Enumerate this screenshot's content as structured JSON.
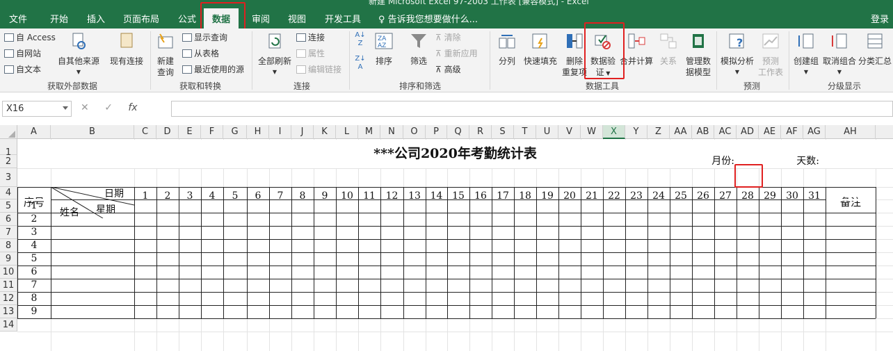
{
  "window": {
    "title": "新建 Microsoft Excel 97-2003 工作表 [兼容模式] - Excel"
  },
  "tabs": [
    "文件",
    "开始",
    "插入",
    "页面布局",
    "公式",
    "数据",
    "审阅",
    "视图",
    "开发工具"
  ],
  "active_tab": "数据",
  "tell_me": "告诉我您想要做什么...",
  "login": "登录",
  "ribbon": {
    "get_external": {
      "access": "自 Access",
      "web": "自网站",
      "text": "自文本",
      "other": "自其他来源",
      "existing": "现有连接",
      "label": "获取外部数据"
    },
    "get_transform": {
      "new_query_1": "新建",
      "new_query_2": "查询",
      "show_query": "显示查询",
      "from_table": "从表格",
      "recent": "最近使用的源",
      "label": "获取和转换"
    },
    "connections": {
      "refresh_all": "全部刷新",
      "connections": "连接",
      "properties": "属性",
      "edit_links": "编辑链接",
      "label": "连接"
    },
    "sort_filter": {
      "sort": "排序",
      "filter": "筛选",
      "clear": "清除",
      "reapply": "重新应用",
      "advanced": "高级",
      "label": "排序和筛选"
    },
    "data_tools": {
      "split": "分列",
      "flash_fill": "快速填充",
      "remove_dup_1": "删除",
      "remove_dup_2": "重复项",
      "validation_1": "数据验",
      "validation_2": "证",
      "consolidate": "合并计算",
      "relations": "关系",
      "manage_model_1": "管理数",
      "manage_model_2": "据模型",
      "label": "数据工具"
    },
    "forecast": {
      "what_if": "模拟分析",
      "forecast_1": "预测",
      "forecast_2": "工作表",
      "label": "预测"
    },
    "outline": {
      "group": "创建组",
      "ungroup": "取消组合",
      "subtotal": "分类汇总",
      "label": "分级显示"
    }
  },
  "formula_bar": {
    "name_box": "X16",
    "cancel": "✕",
    "enter": "✓",
    "fx": "fx",
    "value": ""
  },
  "columns": [
    "A",
    "B",
    "C",
    "D",
    "E",
    "F",
    "G",
    "H",
    "I",
    "J",
    "K",
    "L",
    "M",
    "N",
    "O",
    "P",
    "Q",
    "R",
    "S",
    "T",
    "U",
    "V",
    "W",
    "X",
    "Y",
    "Z",
    "AA",
    "AB",
    "AC",
    "AD",
    "AE",
    "AF",
    "AG",
    "AH"
  ],
  "selected_column": "X",
  "rows": [
    "1",
    "2",
    "3",
    "4",
    "5",
    "6",
    "7",
    "8",
    "9",
    "10",
    "11",
    "12",
    "13",
    "14"
  ],
  "sheet": {
    "title": "***公司2020年考勤统计表",
    "month_label": "月份:",
    "days_label": "天数:",
    "seq_header": "序号",
    "date_header": "日期",
    "weekday_header": "星期",
    "name_header": "姓名",
    "remark_header": "备注",
    "days": [
      "1",
      "2",
      "3",
      "4",
      "5",
      "6",
      "7",
      "8",
      "9",
      "10",
      "11",
      "12",
      "13",
      "14",
      "15",
      "16",
      "17",
      "18",
      "19",
      "20",
      "21",
      "22",
      "23",
      "24",
      "25",
      "26",
      "27",
      "28",
      "29",
      "30",
      "31"
    ],
    "seq_numbers": [
      "1",
      "2",
      "3",
      "4",
      "5",
      "6",
      "7",
      "8",
      "9"
    ]
  }
}
